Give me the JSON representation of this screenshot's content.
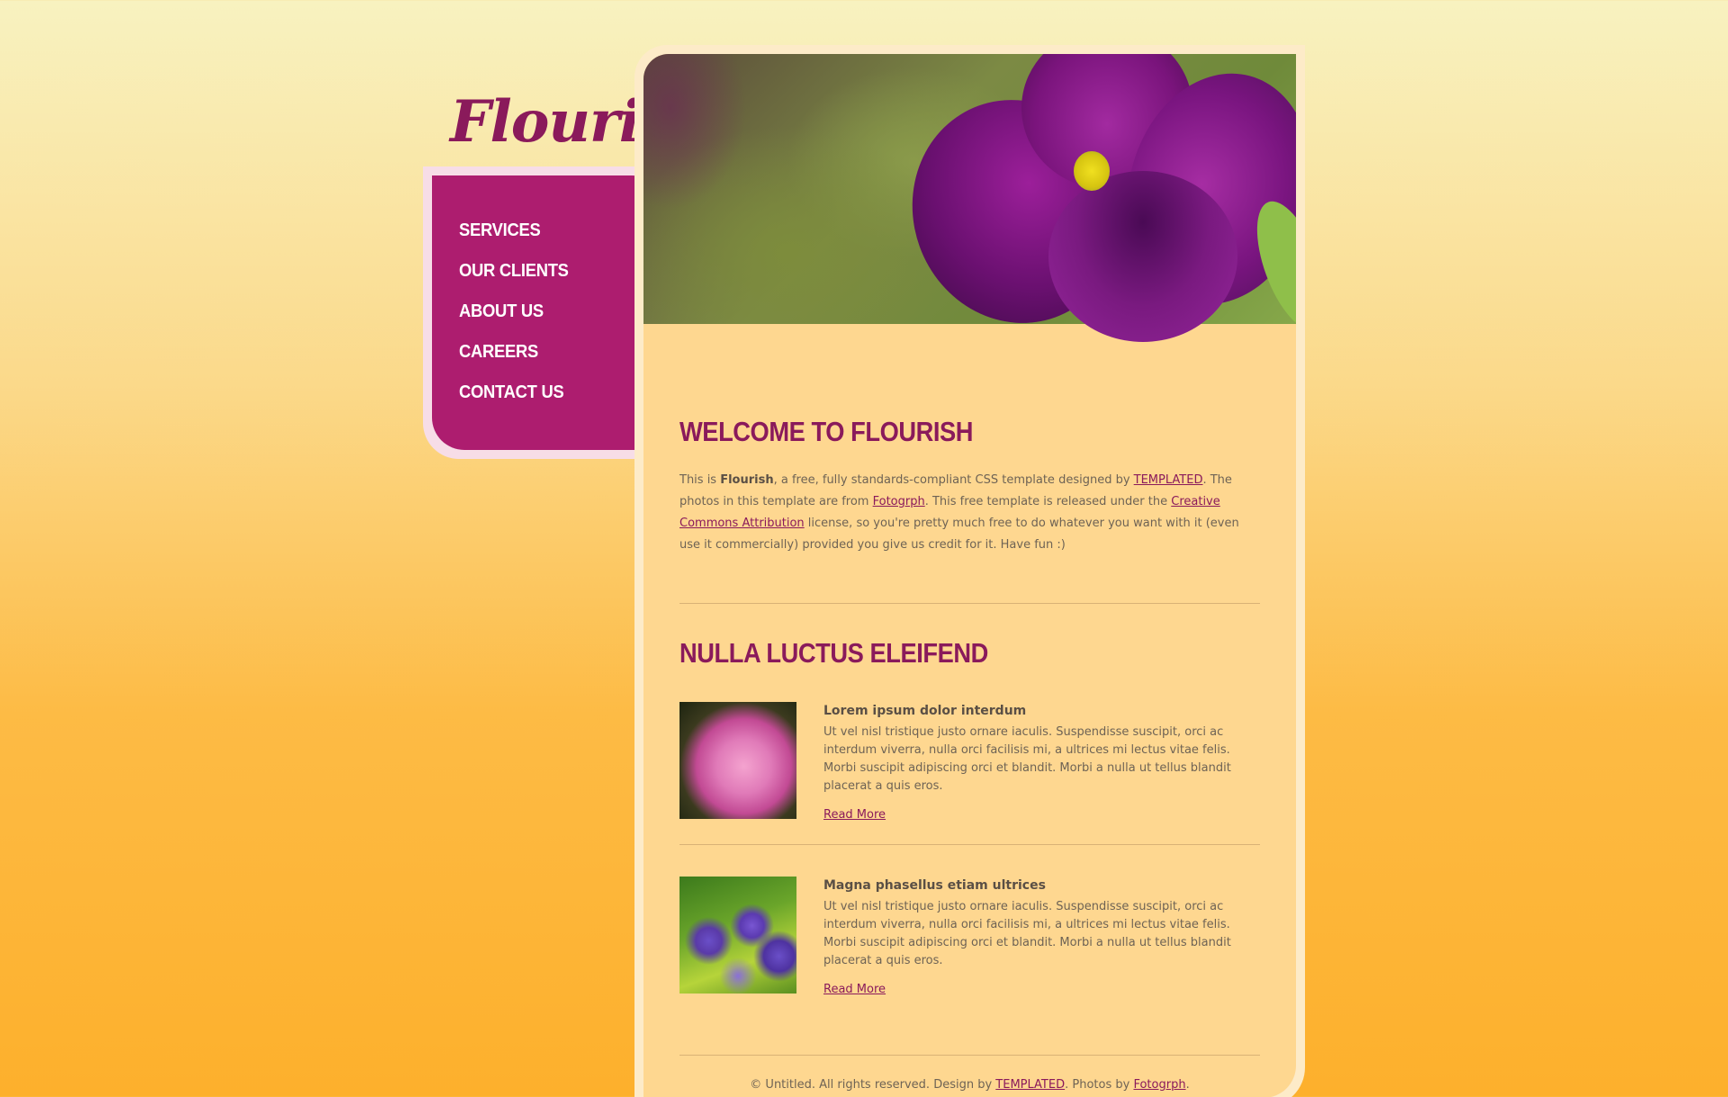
{
  "brand": {
    "logo": "Flourish"
  },
  "nav": {
    "items": [
      {
        "label": "Services"
      },
      {
        "label": "Our Clients"
      },
      {
        "label": "About Us"
      },
      {
        "label": "Careers"
      },
      {
        "label": "Contact Us"
      }
    ]
  },
  "welcome": {
    "heading": "Welcome to Flourish",
    "p1": "This is ",
    "brand_bold": "Flourish",
    "p2": ", a free, fully standards-compliant CSS template designed by ",
    "link_templated": "TEMPLATED",
    "p3": ". The photos in this template are from ",
    "link_fotogrph": "Fotogrph",
    "p4": ". This free template is released under the ",
    "link_cc": "Creative Commons Attribution",
    "p5": " license, so you're pretty much free to do whatever you want with it (even use it commercially) provided you give us credit for it. Have fun :)"
  },
  "section": {
    "heading": "Nulla Luctus Eleifend",
    "items": [
      {
        "title": "Lorem ipsum dolor interdum",
        "body": "Ut vel nisl tristique justo ornare iaculis. Suspendisse suscipit, orci ac interdum viverra, nulla orci facilisis mi, a ultrices mi lectus vitae felis. Morbi suscipit adipiscing orci et blandit. Morbi a nulla ut tellus blandit placerat a quis eros.",
        "link": "Read More"
      },
      {
        "title": "Magna phasellus etiam ultrices",
        "body": "Ut vel nisl tristique justo ornare iaculis. Suspendisse suscipit, orci ac interdum viverra, nulla orci facilisis mi, a ultrices mi lectus vitae felis. Morbi suscipit adipiscing orci et blandit. Morbi a nulla ut tellus blandit placerat a quis eros.",
        "link": "Read More"
      }
    ]
  },
  "footer": {
    "t1": "© Untitled. All rights reserved. Design by ",
    "link_templated": "TEMPLATED",
    "t2": ". Photos by ",
    "link_fotogrph": "Fotogrph",
    "t3": "."
  },
  "colors": {
    "brand": "#8a1a5b",
    "nav_bg": "#ad1d6f",
    "panel_bg": "#fed790"
  }
}
